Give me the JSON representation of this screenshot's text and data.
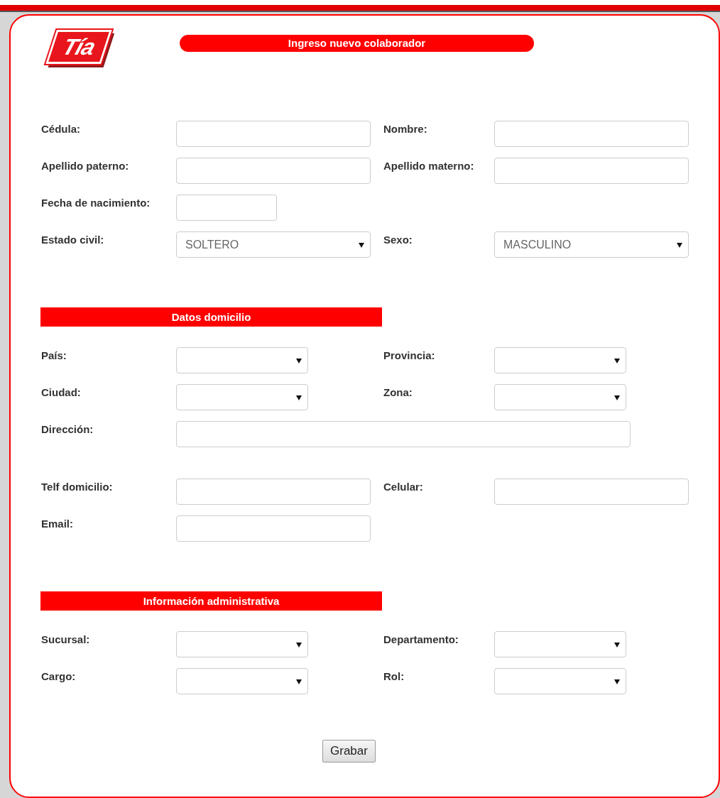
{
  "logo": {
    "text": "Tía"
  },
  "title": "Ingreso nuevo colaborador",
  "sections": [
    {
      "groups": [
        [
          [
            {
              "label": "Cédula:",
              "kind": "text"
            },
            {
              "label": "Nombre:",
              "kind": "text"
            }
          ],
          [
            {
              "label": "Apellido paterno:",
              "kind": "text"
            },
            {
              "label": "Apellido materno:",
              "kind": "text"
            }
          ],
          [
            {
              "label": "Fecha de nacimiento:",
              "kind": "date"
            }
          ],
          [
            {
              "label": "Estado civil:",
              "kind": "select",
              "value": "SOLTERO"
            },
            {
              "label": "Sexo:",
              "kind": "select",
              "value": "MASCULINO"
            }
          ]
        ]
      ]
    },
    {
      "heading": "Datos domicilio",
      "groups": [
        [
          [
            {
              "label": "País:",
              "kind": "select"
            },
            {
              "label": "Provincia:",
              "kind": "select"
            }
          ],
          [
            {
              "label": "Ciudad:",
              "kind": "select"
            },
            {
              "label": "Zona:",
              "kind": "select"
            }
          ],
          [
            {
              "label": "Dirección:",
              "kind": "wide"
            }
          ]
        ],
        [
          [
            {
              "label": "Telf domicilio:",
              "kind": "text"
            },
            {
              "label": "Celular:",
              "kind": "text"
            }
          ],
          [
            {
              "label": "Email:",
              "kind": "text"
            }
          ]
        ]
      ]
    },
    {
      "heading": "Información administrativa",
      "groups": [
        [
          [
            {
              "label": "Sucursal:",
              "kind": "select"
            },
            {
              "label": "Departamento:",
              "kind": "select"
            }
          ],
          [
            {
              "label": "Cargo:",
              "kind": "select"
            },
            {
              "label": "Rol:",
              "kind": "select"
            }
          ]
        ]
      ]
    }
  ],
  "button": "Grabar"
}
